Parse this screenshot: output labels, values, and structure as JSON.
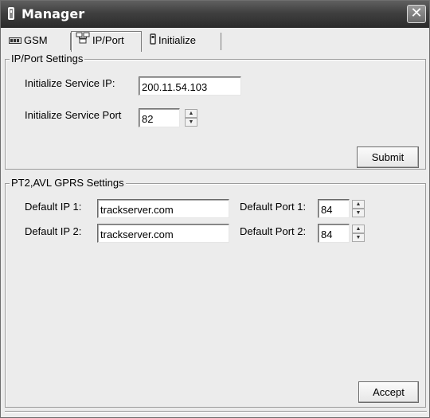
{
  "window": {
    "title": "Manager",
    "close_glyph": "✕"
  },
  "tabs": [
    {
      "label": "GSM",
      "icon": "gsm-icon"
    },
    {
      "label": "IP/Port",
      "icon": "network-icon",
      "active": true
    },
    {
      "label": "Initialize",
      "icon": "device-icon"
    }
  ],
  "ip_port_settings": {
    "title": "IP/Port Settings",
    "service_ip_label": "Initialize Service IP:",
    "service_ip_value": "200.11.54.103",
    "service_port_label": "Initialize Service Port",
    "service_port_value": "82",
    "submit_label": "Submit"
  },
  "gprs_settings": {
    "title": "PT2,AVL GPRS Settings",
    "ip1_label": "Default IP 1:",
    "ip1_value": "trackserver.com",
    "ip2_label": "Default IP 2:",
    "ip2_value": "trackserver.com",
    "port1_label": "Default Port 1:",
    "port1_value": "84",
    "port2_label": "Default Port 2:",
    "port2_value": "84",
    "accept_label": "Accept"
  },
  "spinner": {
    "up": "▲",
    "down": "▼"
  }
}
